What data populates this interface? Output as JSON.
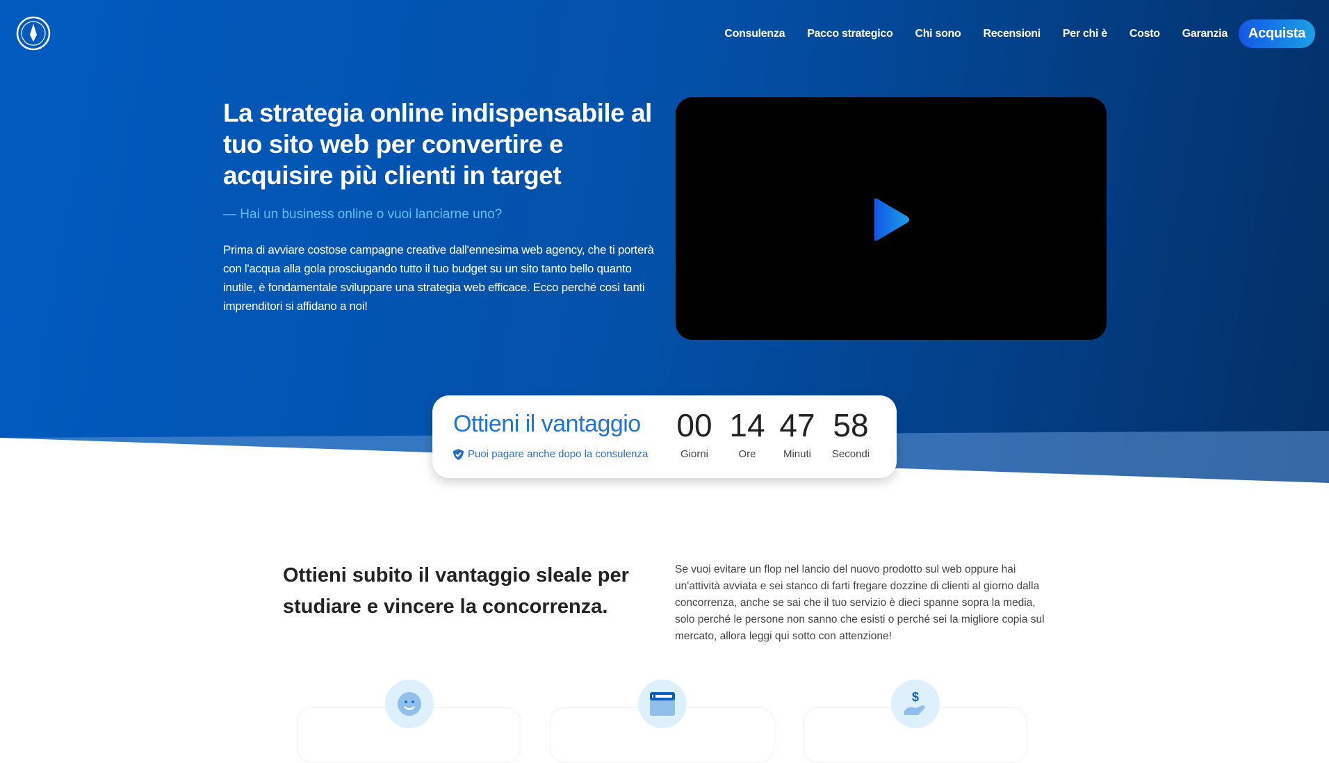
{
  "nav": {
    "items": [
      "Consulenza",
      "Pacco strategico",
      "Chi sono",
      "Recensioni",
      "Per chi è",
      "Costo",
      "Garanzia"
    ],
    "cta": "Acquista"
  },
  "hero": {
    "title": "La strategia online indispensabile al tuo sito web per convertire e acquisire più clienti in target",
    "subtitle": "— Hai un business online o vuoi lanciarne uno?",
    "body": "Prima di avviare costose campagne creative dall'ennesima web agency, che ti porterà con l'acqua alla gola prosciugando tutto il tuo budget su un sito tanto bello quanto inutile, è fondamentale sviluppare una strategia web efficace. Ecco perché così tanti imprenditori si affidano a noi!"
  },
  "countdown": {
    "title": "Ottieni il vantaggio",
    "note": "Puoi pagare anche dopo la consulenza",
    "units": [
      {
        "value": "00",
        "label": "Giorni"
      },
      {
        "value": "14",
        "label": "Ore"
      },
      {
        "value": "47",
        "label": "Minuti"
      },
      {
        "value": "58",
        "label": "Secondi"
      }
    ]
  },
  "section": {
    "heading": "Ottieni subito il vantaggio sleale per studiare e vincere la concorrenza.",
    "text": "Se vuoi evitare un flop nel lancio del nuovo prodotto sul web oppure hai un'attività avviata e sei stanco di farti fregare dozzine di clienti al giorno dalla concorrenza, anche se sai che il tuo servizio è dieci spanne sopra la media, solo perché le persone non sanno che esisti o perché sei la migliore copia sul mercato, allora leggi qui sotto con attenzione!"
  },
  "colors": {
    "accent": "#1e73d8",
    "hero": "#0350a8",
    "icon_bg": "#dff0fd"
  }
}
